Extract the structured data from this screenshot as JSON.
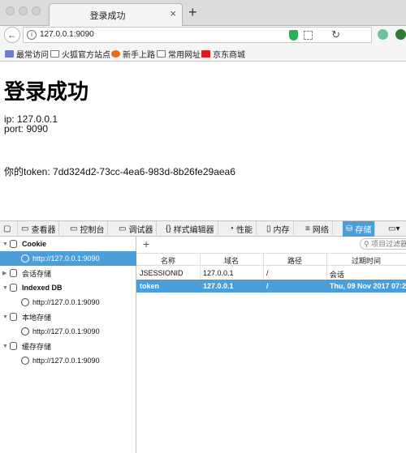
{
  "browser": {
    "tab_title": "登录成功",
    "tab_close": "×",
    "new_tab": "+",
    "url": "127.0.0.1:9090",
    "bookmarks": [
      "最常访问",
      "火狐官方站点",
      "新手上路",
      "常用网址",
      "京东商城"
    ]
  },
  "page": {
    "heading": "登录成功",
    "ip": "ip: 127.0.0.1",
    "port": "port: 9090",
    "token": "你的token: 7dd324d2-73cc-4ea6-983d-8b26fe29aea6"
  },
  "devtools": {
    "tabs": [
      "查看器",
      "控制台",
      "调试器",
      "样式编辑器",
      "性能",
      "内存",
      "网络",
      "存储"
    ],
    "active_tab": "存储",
    "tree": [
      {
        "label": "Cookie",
        "bold": true
      },
      {
        "label": "http://127.0.0.1:9090",
        "selected": true
      },
      {
        "label": "会话存储"
      },
      {
        "label": "Indexed DB",
        "bold": true
      },
      {
        "label": "http://127.0.0.1:9090"
      },
      {
        "label": "本地存储"
      },
      {
        "label": "http://127.0.0.1:9090"
      },
      {
        "label": "缓存存储"
      },
      {
        "label": "http://127.0.0.1:9090"
      }
    ],
    "add_button": "+",
    "filter_placeholder": "项目过滤器",
    "columns": [
      "名称",
      "域名",
      "路径",
      "过期时间"
    ],
    "rows": [
      {
        "name": "JSESSIONID",
        "domain": "127.0.0.1",
        "path": "/",
        "expires": "会话"
      },
      {
        "name": "token",
        "domain": "127.0.0.1",
        "path": "/",
        "expires": "Thu, 09 Nov 2017 07:28"
      }
    ]
  }
}
